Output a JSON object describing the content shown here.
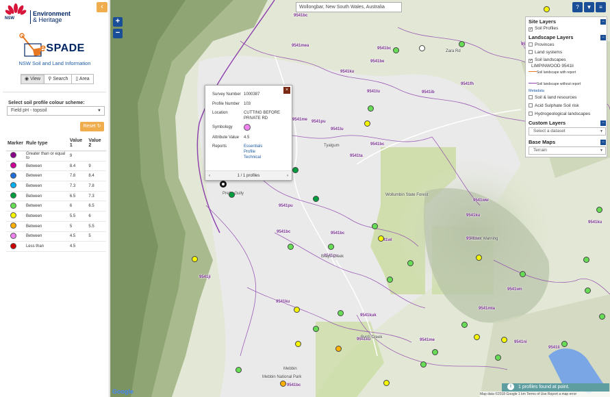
{
  "header": {
    "nsw_label": "NSW",
    "nsw_sublabel": "GOVERNMENT",
    "agency_line1": "Environment",
    "agency_line2": "& Heritage",
    "app_name_prefix": "e",
    "app_name_rest": "SPADE",
    "tagline": "NSW Soil and Land Information",
    "collapse_icon": "chevron-left-icon"
  },
  "view_tabs": [
    {
      "label": "View",
      "icon": "eye-icon",
      "active": true
    },
    {
      "label": "Search",
      "icon": "search-icon",
      "active": false
    },
    {
      "label": "Area",
      "icon": "area-icon",
      "active": false
    }
  ],
  "scheme": {
    "label": "Select soil profile colour scheme:",
    "selected": "Field pH - topsoil",
    "reset_label": "Reset"
  },
  "legend": {
    "headers": [
      "Marker",
      "Rule type",
      "Value 1",
      "Value 2"
    ],
    "rows": [
      {
        "color": "#8b008b",
        "rule": "Greater than or equal to",
        "v1": "9",
        "v2": ""
      },
      {
        "color": "#cc0099",
        "rule": "Between",
        "v1": "8.4",
        "v2": "9"
      },
      {
        "color": "#1e6fd9",
        "rule": "Between",
        "v1": "7.8",
        "v2": "8.4"
      },
      {
        "color": "#00b0f0",
        "rule": "Between",
        "v1": "7.3",
        "v2": "7.8"
      },
      {
        "color": "#009e3c",
        "rule": "Between",
        "v1": "6.5",
        "v2": "7.3"
      },
      {
        "color": "#66dd55",
        "rule": "Between",
        "v1": "6",
        "v2": "6.5"
      },
      {
        "color": "#f5f500",
        "rule": "Between",
        "v1": "5.5",
        "v2": "6"
      },
      {
        "color": "#ffb000",
        "rule": "Between",
        "v1": "5",
        "v2": "5.5"
      },
      {
        "color": "#ee82ee",
        "rule": "Between",
        "v1": "4.5",
        "v2": "5"
      },
      {
        "color": "#cc0000",
        "rule": "Less than",
        "v1": "4.5",
        "v2": ""
      }
    ]
  },
  "map": {
    "search_value": "Wollongbar, New South Wales, Australia",
    "zoom_in": "+",
    "zoom_out": "−",
    "status": "1 profiles found at point.",
    "attribution": "Map data ©2018 Google   1 km   Terms of Use   Report a map error",
    "google": "Google",
    "tool_icons": [
      "help-icon",
      "bookmark-icon",
      "list-icon"
    ]
  },
  "layers": {
    "site_title": "Site Layers",
    "site_items": [
      {
        "label": "Soil Profiles",
        "checked": true
      }
    ],
    "landscape_title": "Landscape Layers",
    "landscape_items": [
      {
        "label": "Provinces",
        "checked": false
      },
      {
        "label": "Land systems",
        "checked": false
      },
      {
        "label": "Soil landscapes",
        "checked": true
      }
    ],
    "landscape_sub": "LIMPINWOOD 9541li",
    "legend_with": "Soil landscape with report",
    "legend_without": "Soil landscape without report",
    "metadata": "Metadata",
    "other_items": [
      {
        "label": "Soil & land resources",
        "checked": false
      },
      {
        "label": "Acid Sulphate Soil risk",
        "checked": false
      },
      {
        "label": "Hydrogeological landscapes",
        "checked": false
      }
    ],
    "custom_title": "Custom Layers",
    "custom_select": "Select a dataset",
    "base_title": "Base Maps",
    "base_select": "Terrain"
  },
  "popup": {
    "survey_label": "Survey Number",
    "survey_value": "1000387",
    "profile_label": "Profile Number",
    "profile_value": "103",
    "location_label": "Location",
    "location_value_1": "CUTTING BEFORE",
    "location_value_2": "PRIVATE RD",
    "symbology_label": "Symbology",
    "symbology_color": "#ee82ee",
    "attr_label": "Attribute Value",
    "attr_value": "4.5",
    "reports_label": "Reports",
    "report_links": [
      "Essentials",
      "Profile",
      "Technical"
    ],
    "pager": "1 / 1 profiles"
  },
  "map_labels": [
    "9541bc",
    "9541ku",
    "9541tu",
    "9541be",
    "9541bc",
    "9541fh",
    "9541ib",
    "9541pu",
    "9541me",
    "9541lu",
    "9541ku",
    "9541mea",
    "9541cu",
    "9541bc",
    "9541pu",
    "9541ta",
    "9541bc",
    "9541pu",
    "9541fh",
    "9541bc",
    "9541bc",
    "9541pu",
    "9541pa",
    "9541ku",
    "9541wl",
    "9541bc",
    "9541ww",
    "9541ku",
    "9541bu",
    "9541bc",
    "9541ji",
    "9541ku",
    "9541lm",
    "9541mta",
    "9541bc",
    "9541wn",
    "9541kuk",
    "9541ku",
    "9541me",
    "9541ni",
    "9541li",
    "9541ku",
    "9541bc",
    "9541ni",
    "9541fh"
  ],
  "place_labels": [
    "Tyalgum",
    "Brays Creek",
    "Byrril Creek",
    "Mebbin",
    "Mebbin National Park",
    "Wollumbin State Forest",
    "Mount Warning",
    "Pretty Gully",
    "Zara Rd",
    "Kunghur"
  ]
}
